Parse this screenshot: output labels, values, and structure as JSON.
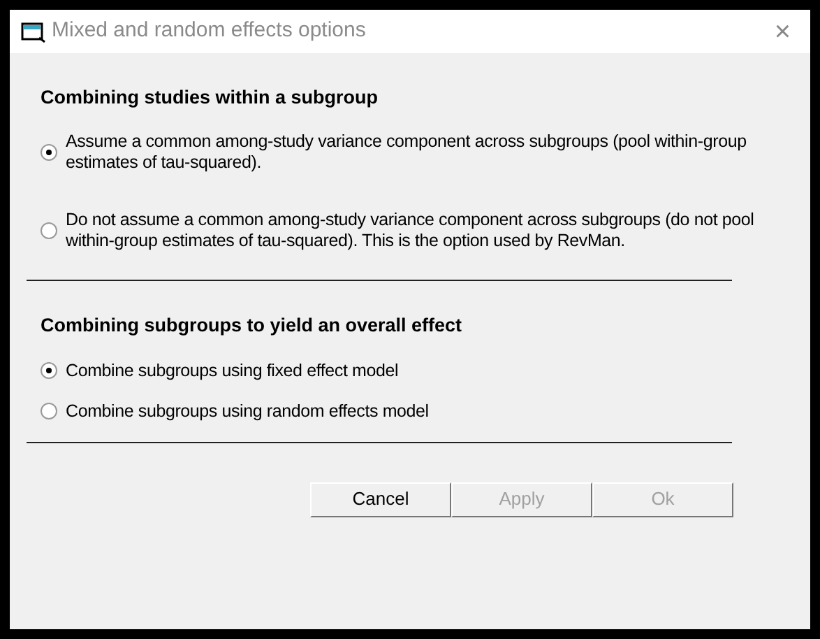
{
  "window": {
    "title": "Mixed and random effects options",
    "close": "×"
  },
  "sections": [
    {
      "heading": "Combining studies within a subgroup",
      "options": [
        {
          "label": "Assume a common among-study variance component across subgroups (pool within-group estimates of tau-squared).",
          "selected": true
        },
        {
          "label": "Do not assume a common among-study variance component across subgroups (do not pool within-group estimates of tau-squared). This is the option used by RevMan.",
          "selected": false
        }
      ]
    },
    {
      "heading": "Combining subgroups to yield an overall effect",
      "options": [
        {
          "label": "Combine subgroups using fixed effect model",
          "selected": true
        },
        {
          "label": "Combine subgroups using random effects model",
          "selected": false
        }
      ]
    }
  ],
  "buttons": [
    {
      "label": "Cancel",
      "disabled": false
    },
    {
      "label": "Apply",
      "disabled": true
    },
    {
      "label": "Ok",
      "disabled": true
    }
  ]
}
